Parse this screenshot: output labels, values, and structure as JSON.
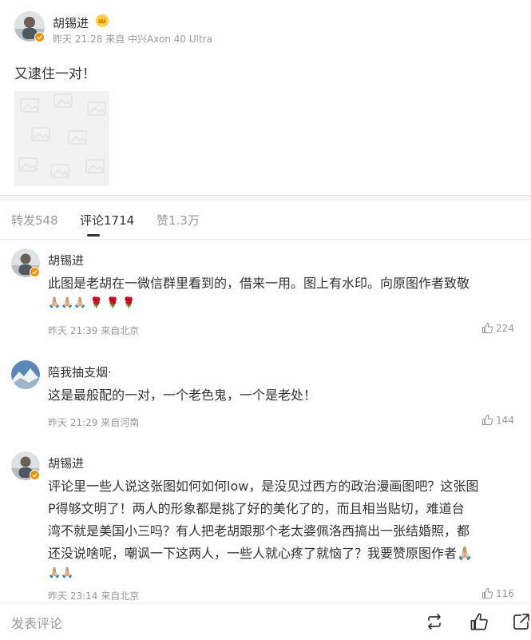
{
  "post": {
    "author": "胡锡进",
    "time": "昨天 21:28",
    "source": "来自 中兴Axon 40 Ultra",
    "text": "又逮住一对！"
  },
  "tabs": [
    {
      "label": "转发548",
      "active": false
    },
    {
      "label": "评论1714",
      "active": true
    },
    {
      "label": "赞1.3万",
      "active": false
    }
  ],
  "comments": [
    {
      "user": "胡锡进",
      "text_lines": [
        "此图是老胡在一微信群里看到的，借来一用。图上有水印。向原图作者致敬"
      ],
      "emojis": [
        "🙏🏼🙏🏼🙏🏼",
        "🌹",
        "🌹",
        "🌹"
      ],
      "time": "昨天 21:39",
      "source": "来自北京",
      "likes": "224"
    },
    {
      "user": "陪我抽支烟·",
      "text_lines": [
        "这是最般配的一对，一个老色鬼，一个是老处！"
      ],
      "time": "昨天 21:29",
      "source": "来自河南",
      "likes": "144"
    },
    {
      "user": "胡锡进",
      "text_lines": [
        "评论里一些人说这张图如何如何low，是没见过西方的政治漫画图吧？这张图",
        "P得够文明了！两人的形象都是挑了好的美化了的，而且相当贴切，难道台",
        "湾不就是美国小三吗？有人把老胡跟那个老太婆佩洛西搞出一张结婚照，都",
        "还没说啥呢，嘲讽一下这两人，一些人就心疼了就恼了？我要赞原图作者🙏🏼",
        "🙏🏼🙏🏼"
      ],
      "time": "昨天 23:14",
      "source": "来自北京",
      "likes": "116"
    }
  ],
  "bottombar": {
    "placeholder": "发表评论"
  },
  "colors": {
    "badge": "#f29100",
    "text": "#333333",
    "muted": "#999999"
  },
  "icons": [
    "crown-icon",
    "verified-badge-icon",
    "image-placeholder-icon",
    "thumbs-up-icon",
    "share-icon",
    "more-icon"
  ]
}
